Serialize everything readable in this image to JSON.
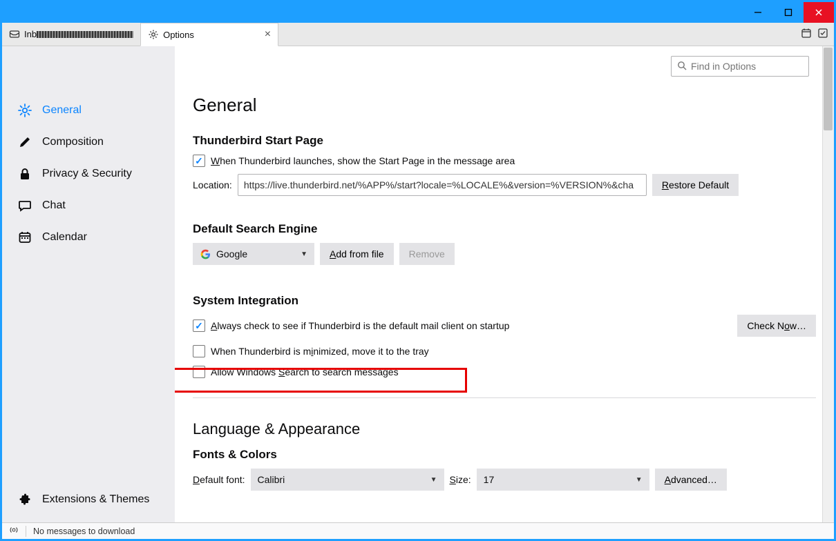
{
  "tabs": {
    "inbox": {
      "label": "Inb"
    },
    "options": {
      "label": "Options"
    }
  },
  "search": {
    "placeholder": "Find in Options"
  },
  "sidebar": {
    "general": "General",
    "composition": "Composition",
    "privacy": "Privacy & Security",
    "chat": "Chat",
    "calendar": "Calendar",
    "extensions": "Extensions & Themes"
  },
  "page": {
    "heading": "General",
    "start": {
      "title": "Thunderbird Start Page",
      "check_pre": "W",
      "check_post": "hen Thunderbird launches, show the Start Page in the message area",
      "location_label": "Location:",
      "location_value": "https://live.thunderbird.net/%APP%/start?locale=%LOCALE%&version=%VERSION%&cha",
      "restore_pre": "R",
      "restore_post": "estore Default"
    },
    "search_engine": {
      "title": "Default Search Engine",
      "selected": "Google",
      "add_pre": "A",
      "add_post": "dd from file",
      "remove": "Remove"
    },
    "system": {
      "title": "System Integration",
      "always_pre": "A",
      "always_post": "lways check to see if Thunderbird is the default mail client on startup",
      "checknow_pre": "Check N",
      "checknow_post": "ow…",
      "tray_pre": "When Thunderbird is m",
      "tray_post": "inimized, move it to the tray",
      "winsearch_pre": "Allow Windows S",
      "winsearch_post": "earch to search messages"
    },
    "lang": {
      "heading": "Language & Appearance",
      "fonts_title": "Fonts & Colors",
      "default_font_pre": "D",
      "default_font_post": "efault font:",
      "font_value": "Calibri",
      "size_pre": "S",
      "size_post": "ize:",
      "size_value": "17",
      "advanced_pre": "A",
      "advanced_post": "dvanced…"
    }
  },
  "status": {
    "text": "No messages to download"
  }
}
